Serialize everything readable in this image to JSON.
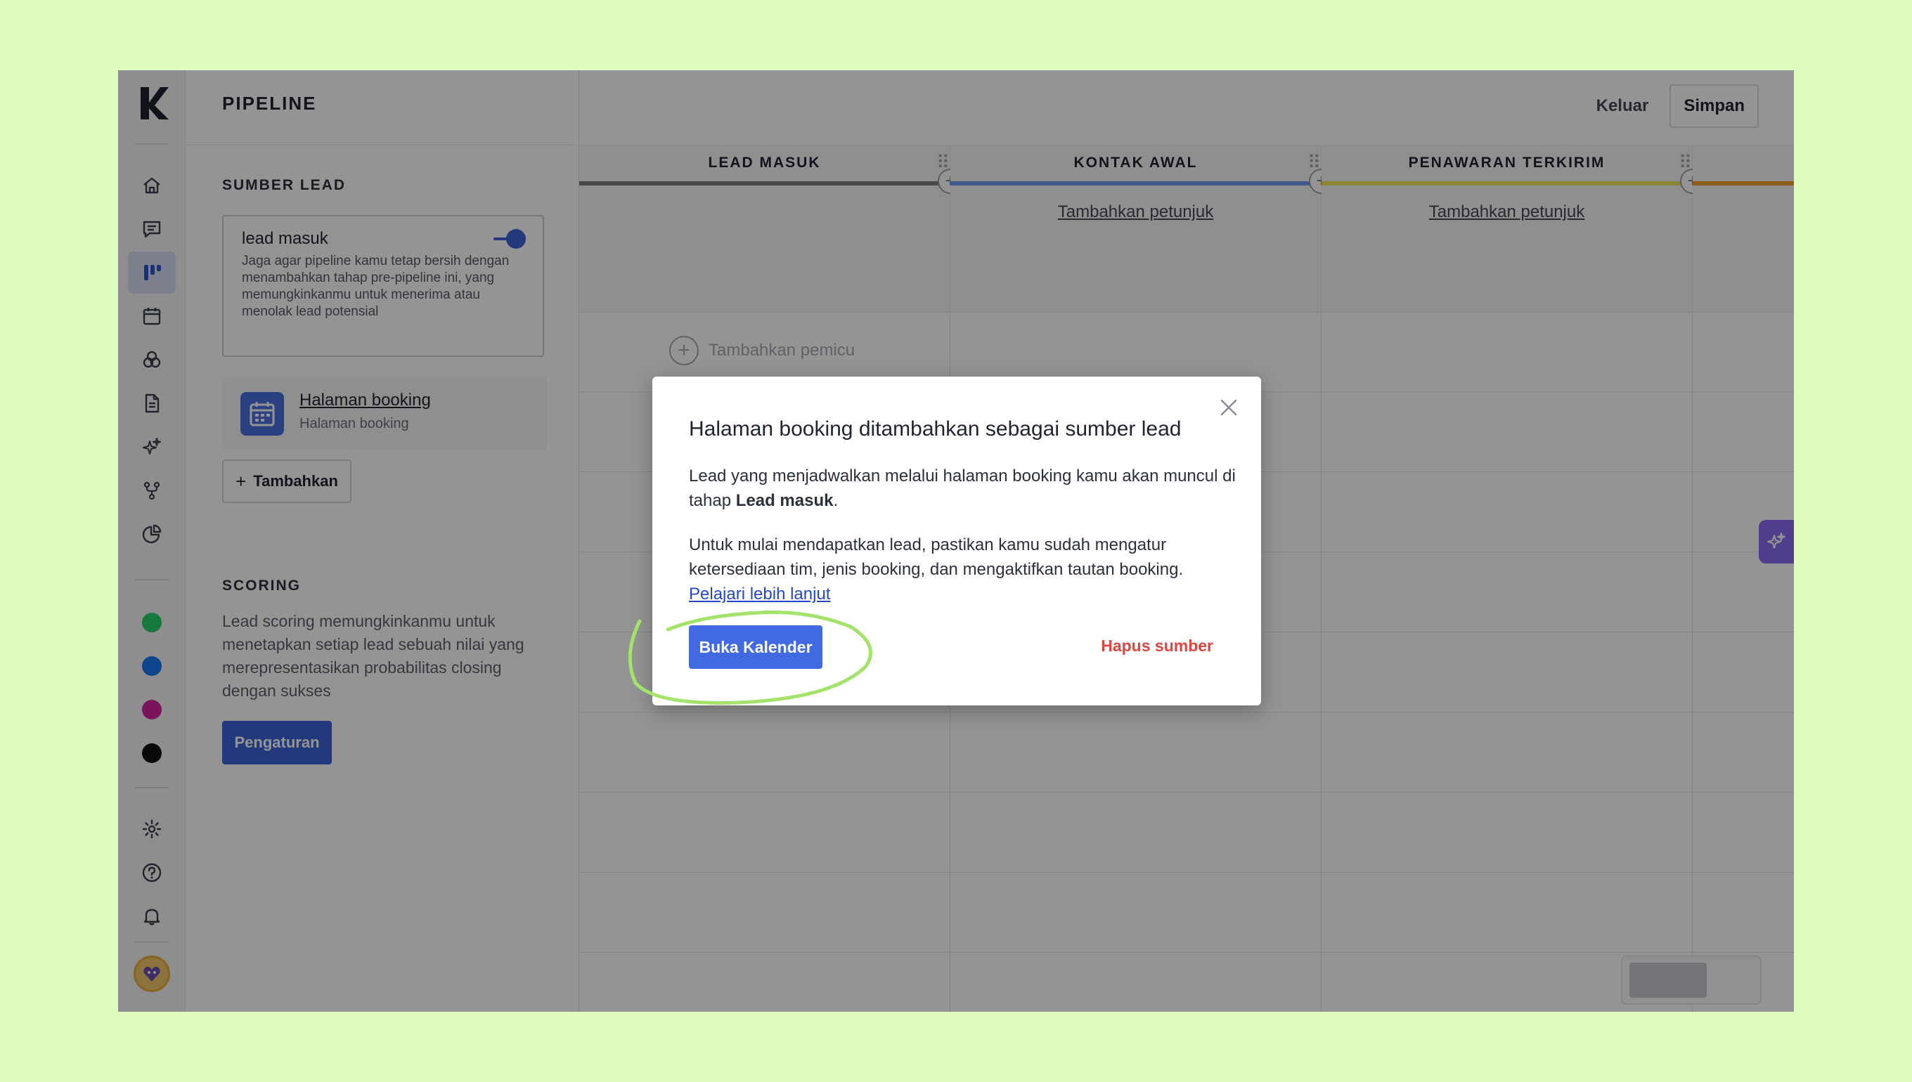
{
  "sidebar": {
    "items": [
      {
        "icon": "home-icon"
      },
      {
        "icon": "chat-icon"
      },
      {
        "icon": "pipeline-icon",
        "active": true
      },
      {
        "icon": "calendar-icon"
      },
      {
        "icon": "segments-icon"
      },
      {
        "icon": "document-icon"
      },
      {
        "icon": "sparkle-icon"
      },
      {
        "icon": "flow-icon"
      },
      {
        "icon": "reports-icon"
      }
    ],
    "channels": [
      {
        "icon": "whatsapp-icon",
        "color": "#25d366"
      },
      {
        "icon": "facebook-icon",
        "color": "#1877f2"
      },
      {
        "icon": "instagram-icon",
        "color": "#d6249f"
      },
      {
        "icon": "tiktok-icon",
        "color": "#111111"
      }
    ],
    "bottom": [
      {
        "icon": "gear-icon"
      },
      {
        "icon": "help-icon"
      },
      {
        "icon": "bell-icon"
      }
    ]
  },
  "panel": {
    "title": "PIPELINE",
    "lead_source_title": "SUMBER LEAD",
    "lead_card": {
      "name": "lead masuk",
      "description": "Jaga agar pipeline kamu tetap bersih dengan menambahkan tahap pre-pipeline ini, yang memungkinkanmu untuk menerima atau menolak lead potensial",
      "toggle_on": true
    },
    "booking_card": {
      "title": "Halaman booking",
      "subtitle": "Halaman booking"
    },
    "add_label": "Tambahkan",
    "scoring_title": "SCORING",
    "scoring_desc": "Lead scoring memungkinkanmu untuk menetapkan setiap lead sebuah nilai yang merepresentasikan probabilitas closing dengan sukses",
    "settings_label": "Pengaturan"
  },
  "header": {
    "exit_label": "Keluar",
    "save_label": "Simpan"
  },
  "board": {
    "columns": [
      {
        "name": "LEAD MASUK",
        "color": "#7a7a7a",
        "link": ""
      },
      {
        "name": "KONTAK AWAL",
        "color": "#6f9df0",
        "link": "Tambahkan petunjuk"
      },
      {
        "name": "PENAWARAN TERKIRIM",
        "color": "#f3e35a",
        "link": "Tambahkan petunjuk"
      },
      {
        "name": "",
        "color": "#f29b2f",
        "link": ""
      }
    ],
    "trigger_label": "Tambahkan pemicu"
  },
  "modal": {
    "title": "Halaman booking ditambahkan sebagai sumber lead",
    "p1_prefix": "Lead yang menjadwalkan melalui halaman booking kamu akan muncul di tahap ",
    "p1_bold": "Lead masuk",
    "p1_suffix": ".",
    "p2": "Untuk mulai mendapatkan lead, pastikan kamu sudah mengatur ketersediaan tim, jenis booking, dan mengaktifkan tautan booking.",
    "link": "Pelajari lebih lanjut",
    "primary_label": "Buka Kalender",
    "danger_label": "Hapus sumber"
  }
}
